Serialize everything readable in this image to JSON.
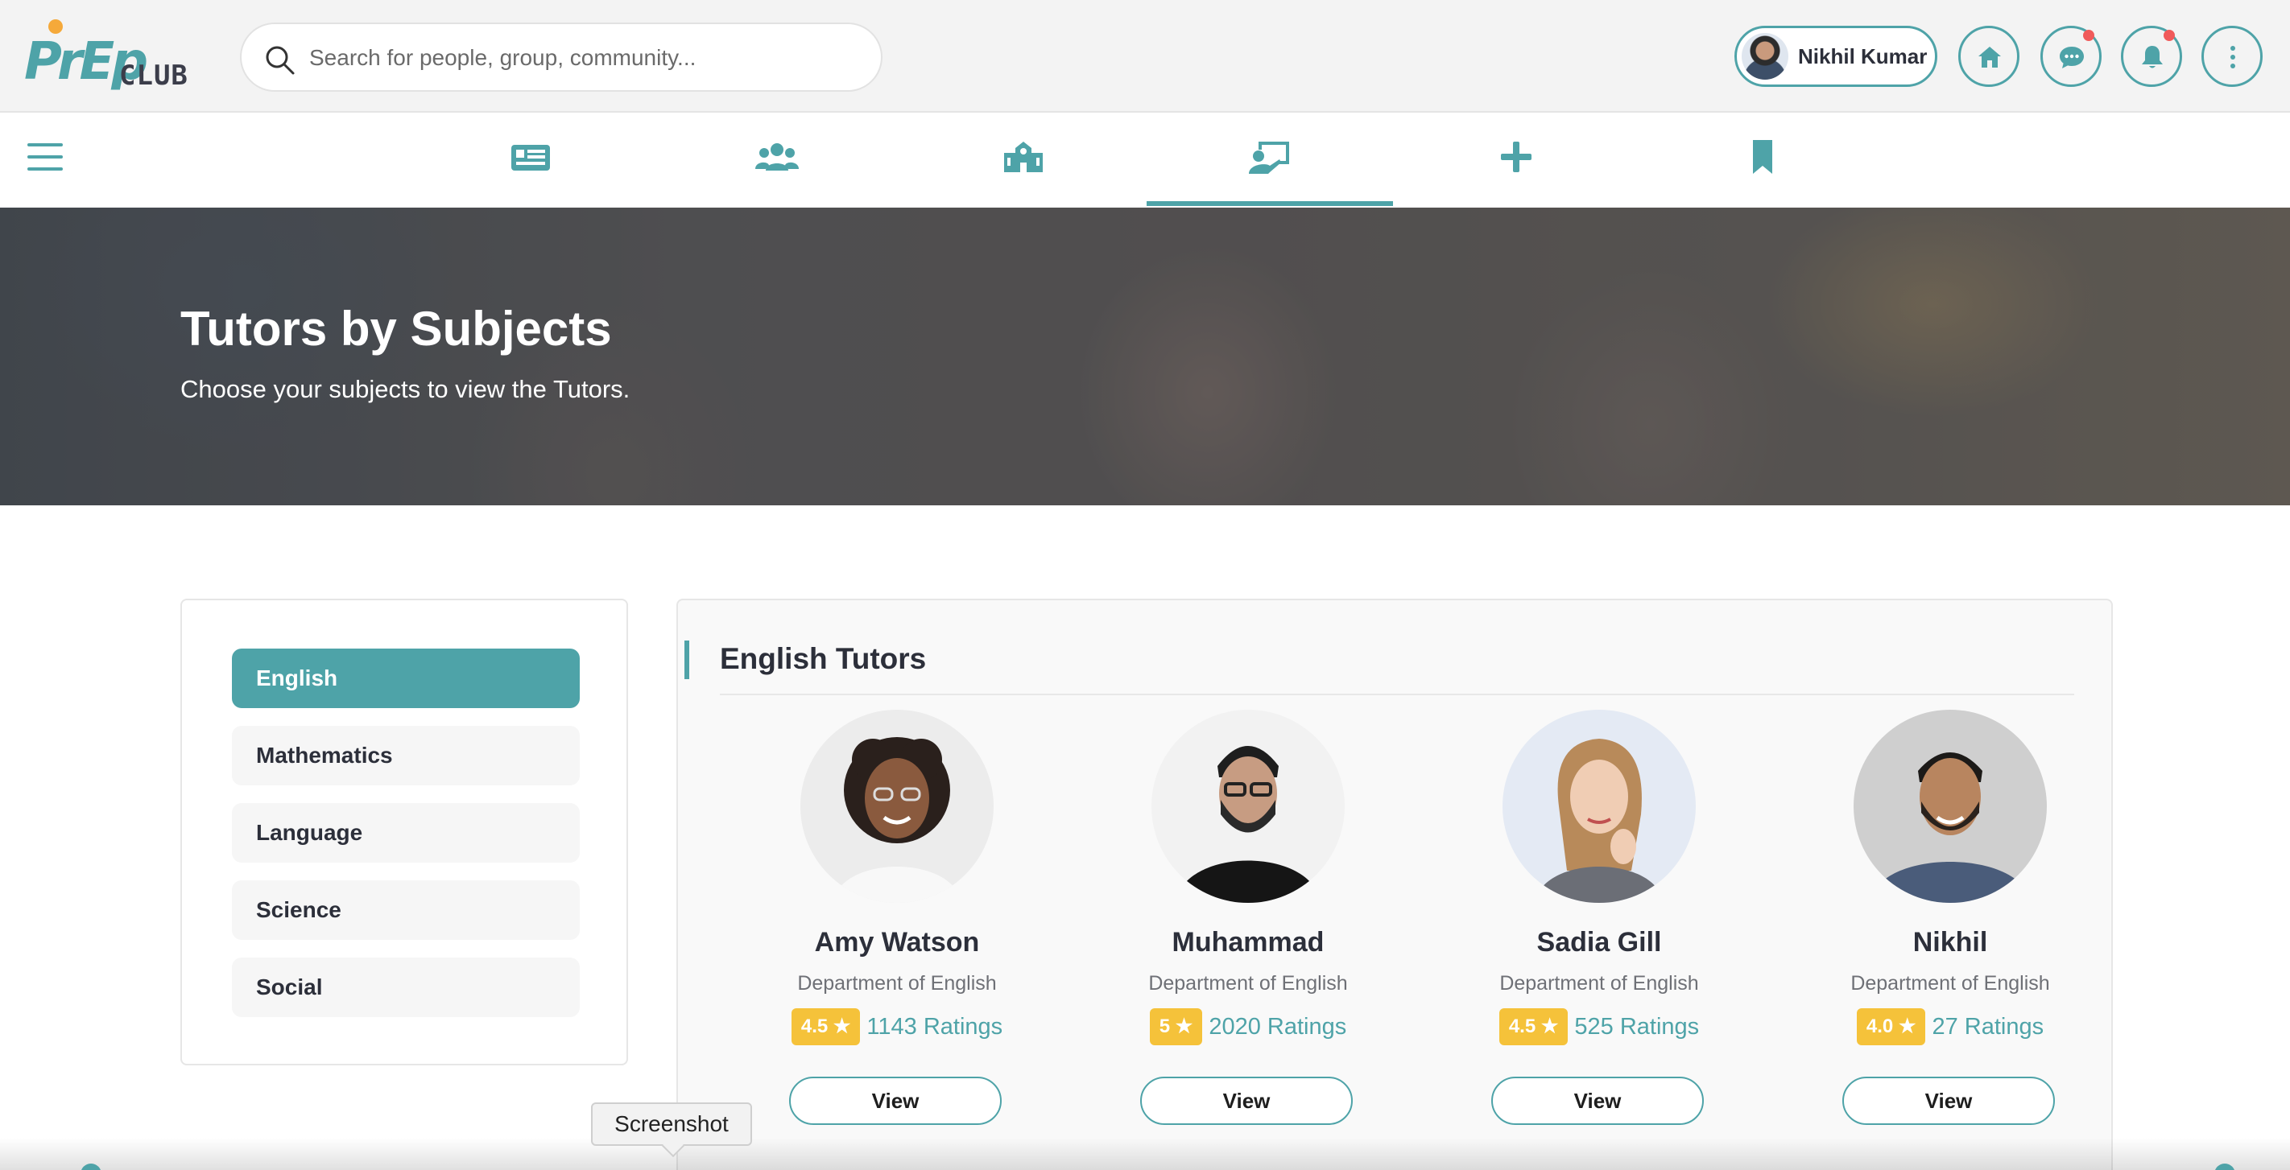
{
  "header": {
    "logo_text_main": "PrEp",
    "logo_text_club": "CLUB",
    "search_placeholder": "Search for people, group, community...",
    "user_name": "Nikhil Kumar"
  },
  "nav": {
    "tabs": [
      "newsfeed-icon",
      "groups-icon",
      "institution-icon",
      "tutors-icon",
      "add-icon",
      "bookmark-icon"
    ],
    "active_tab": "tutors-icon"
  },
  "hero": {
    "title": "Tutors by Subjects",
    "subtitle": "Choose your subjects to view the Tutors."
  },
  "subjects": [
    {
      "label": "English",
      "active": true
    },
    {
      "label": "Mathematics",
      "active": false
    },
    {
      "label": "Language",
      "active": false
    },
    {
      "label": "Science",
      "active": false
    },
    {
      "label": "Social",
      "active": false
    }
  ],
  "tutors_panel": {
    "title": "English Tutors",
    "tutors": [
      {
        "name": "Amy Watson",
        "department": "Department of English",
        "rating": "4.5",
        "ratings_count": "1143 Ratings",
        "button": "View"
      },
      {
        "name": "Muhammad",
        "department": "Department of English",
        "rating": "5",
        "ratings_count": "2020 Ratings",
        "button": "View"
      },
      {
        "name": "Sadia Gill",
        "department": "Department of English",
        "rating": "4.5",
        "ratings_count": "525 Ratings",
        "button": "View"
      },
      {
        "name": "Nikhil",
        "department": "Department of English",
        "rating": "4.0",
        "ratings_count": "27 Ratings",
        "button": "View"
      }
    ]
  },
  "tooltip": "Screenshot",
  "colors": {
    "accent": "#4ea3a8",
    "rating": "#f5c23a",
    "notification": "#f05a5a"
  }
}
